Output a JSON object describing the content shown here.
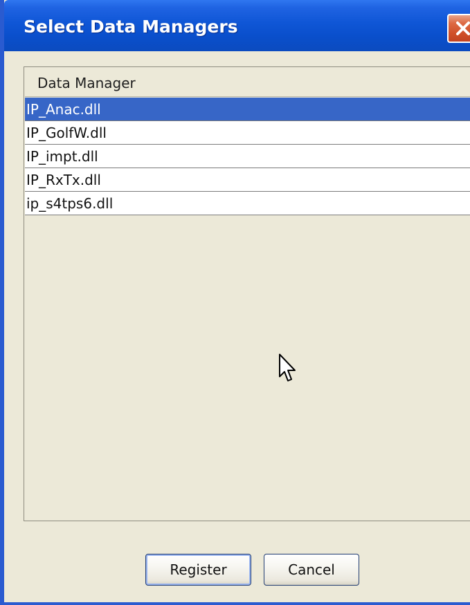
{
  "window": {
    "title": "Select Data Managers"
  },
  "list": {
    "column_header": "Data Manager",
    "items": [
      {
        "label": "IP_Anac.dll",
        "selected": true
      },
      {
        "label": "IP_GolfW.dll",
        "selected": false
      },
      {
        "label": "IP_impt.dll",
        "selected": false
      },
      {
        "label": "IP_RxTx.dll",
        "selected": false
      },
      {
        "label": "ip_s4tps6.dll",
        "selected": false
      }
    ]
  },
  "buttons": {
    "register": "Register",
    "cancel": "Cancel"
  },
  "icons": {
    "close": "close-icon",
    "cursor": "mouse-pointer-icon"
  },
  "colors": {
    "titlebar": "#0f56d6",
    "selection": "#3766c7",
    "window_bg": "#ece9d8",
    "close_button": "#cf4f28"
  }
}
